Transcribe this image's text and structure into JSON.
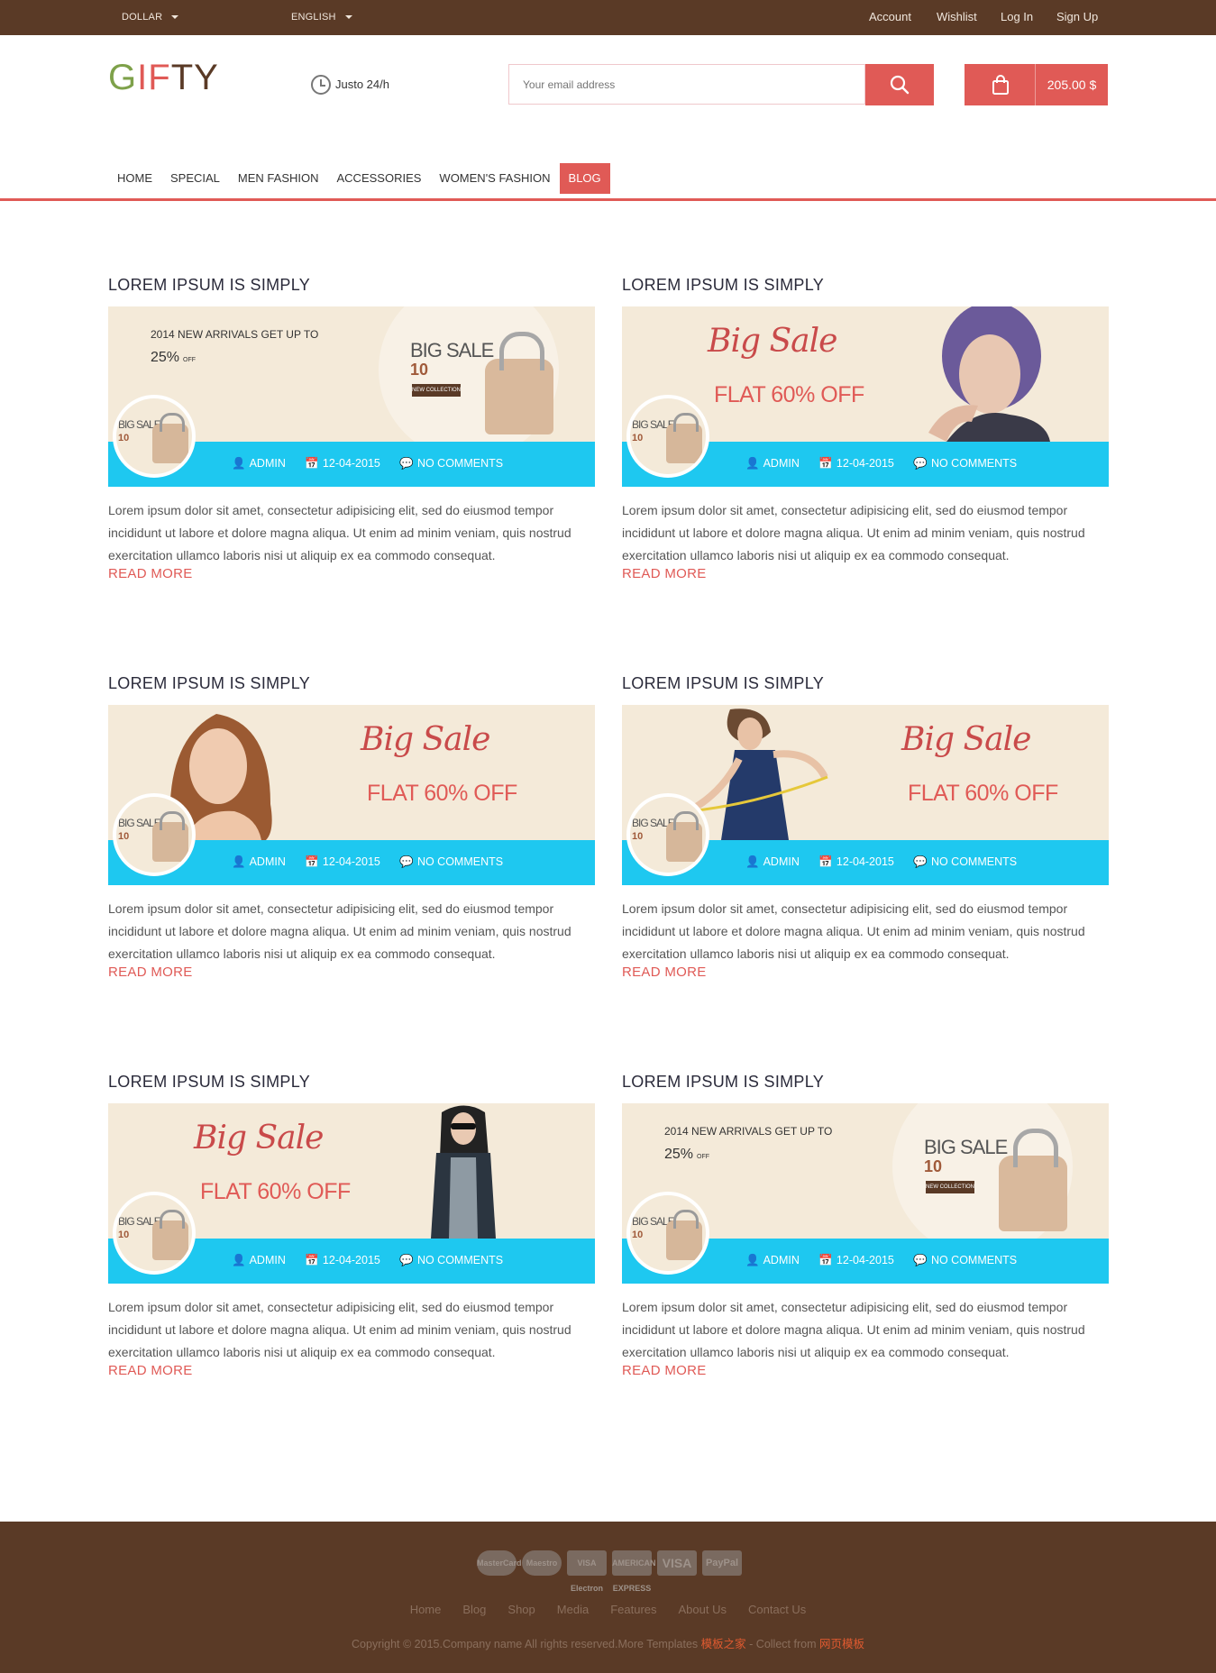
{
  "topbar": {
    "currency": "DOLLAR",
    "language": "ENGLISH",
    "links": [
      "Account",
      "Wishlist",
      "Log In",
      "Sign Up"
    ]
  },
  "header": {
    "logo": [
      "G",
      "I",
      "F",
      "T",
      "Y"
    ],
    "hours": "Justo 24/h",
    "search_placeholder": "Your email address",
    "cart_amount": "205.00 $"
  },
  "nav": {
    "items": [
      "HOME",
      "SPECIAL",
      "MEN FASHION",
      "ACCESSORIES",
      "WOMEN'S FASHION",
      "BLOG"
    ],
    "active": "BLOG"
  },
  "posts": [
    {
      "title": "LOREM IPSUM IS SIMPLY",
      "author": "ADMIN",
      "date": "12-04-2015",
      "comments": "NO COMMENTS",
      "banner": "arrivals"
    },
    {
      "title": "LOREM IPSUM IS SIMPLY",
      "author": "ADMIN",
      "date": "12-04-2015",
      "comments": "NO COMMENTS",
      "banner": "woman-purple"
    },
    {
      "title": "LOREM IPSUM IS SIMPLY",
      "author": "ADMIN",
      "date": "12-04-2015",
      "comments": "NO COMMENTS",
      "banner": "woman-blonde"
    },
    {
      "title": "LOREM IPSUM IS SIMPLY",
      "author": "ADMIN",
      "date": "12-04-2015",
      "comments": "NO COMMENTS",
      "banner": "woman-dancing"
    },
    {
      "title": "LOREM IPSUM IS SIMPLY",
      "author": "ADMIN",
      "date": "12-04-2015",
      "comments": "NO COMMENTS",
      "banner": "woman-sunglasses"
    },
    {
      "title": "LOREM IPSUM IS SIMPLY",
      "author": "ADMIN",
      "date": "12-04-2015",
      "comments": "NO COMMENTS",
      "banner": "arrivals"
    }
  ],
  "excerpt": "Lorem ipsum dolor sit amet, consectetur adipisicing elit, sed do eiusmod tempor incididunt ut labore et dolore magna aliqua. Ut enim ad minim veniam, quis nostrud exercitation ullamco laboris nisi ut aliquip ex ea commodo consequat.",
  "read_more": "READ MORE",
  "banner_text": {
    "arrivals": "2014 NEW ARRIVALS GET UP TO",
    "pct": "25%",
    "off": "OFF",
    "big_sale": "BIG SALE",
    "ten": "10",
    "script": "Big Sale",
    "flat": "FLAT 60% OFF",
    "collection": "NEW COLLECTION"
  },
  "footer": {
    "payment_cards": [
      "MasterCard",
      "Maestro",
      "VISA Electron",
      "AMERICAN EXPRESS",
      "VISA",
      "PayPal"
    ],
    "links": [
      "Home",
      "Blog",
      "Shop",
      "Media",
      "Features",
      "About Us",
      "Contact Us"
    ],
    "copyright": "Copyright © 2015.Company name All rights reserved.More Templates",
    "site1": "模板之家",
    "sep": " - Collect from ",
    "site2": "网页模板"
  },
  "colors": {
    "accent": "#e05a56",
    "brown": "#5a3a26",
    "cyan": "#1ec8f0",
    "cream": "#f4ead9"
  }
}
